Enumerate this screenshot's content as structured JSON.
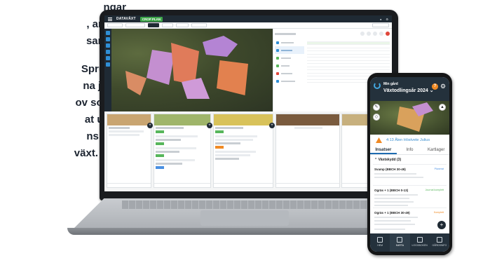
{
  "side_text": {
    "lines": [
      "ngar",
      ", antalet",
      "samt",
      "Sprut-",
      "na jobba",
      "ov som",
      "at under",
      "ns Juul,",
      "växt."
    ]
  },
  "laptop": {
    "topbar": {
      "brand": "DATAVÄXT",
      "app": "CROP PLAN"
    },
    "crop_cards": [
      {
        "label": "",
        "color": "#c9a571"
      },
      {
        "label": "",
        "color": "#9fb56a"
      },
      {
        "label": "",
        "color": "#d8c25a"
      },
      {
        "label": "",
        "color": "#7a5b3e"
      },
      {
        "label": "",
        "color": "#c7b07e"
      }
    ]
  },
  "phone": {
    "header_title": "Min gård",
    "header_sub": "Växtodlingsår 2024 ⌄",
    "help_label": "?",
    "field_title": "4:13 Ålen Höstvete Julius",
    "tabs": [
      "Insatser",
      "Info",
      "Kartlager"
    ],
    "section": "Växtskydd (3)",
    "items": [
      {
        "name": "Svamp (BBCH 30-49)",
        "badge": "Planerat",
        "badge_color": "#4a90e2"
      },
      {
        "name": "Ogräs + 1 (BBCH 0-13)",
        "badge": "Journal komplett",
        "badge_color": "#57b65b"
      },
      {
        "name": "Ogräs + 1 (BBCH 30-49)",
        "badge": "Komplett",
        "badge_color": "#f08a24"
      }
    ],
    "fab": "+",
    "footer": [
      "HEM",
      "KARTA",
      "LOGGBOKEN",
      "GÅRDSINFO"
    ]
  }
}
